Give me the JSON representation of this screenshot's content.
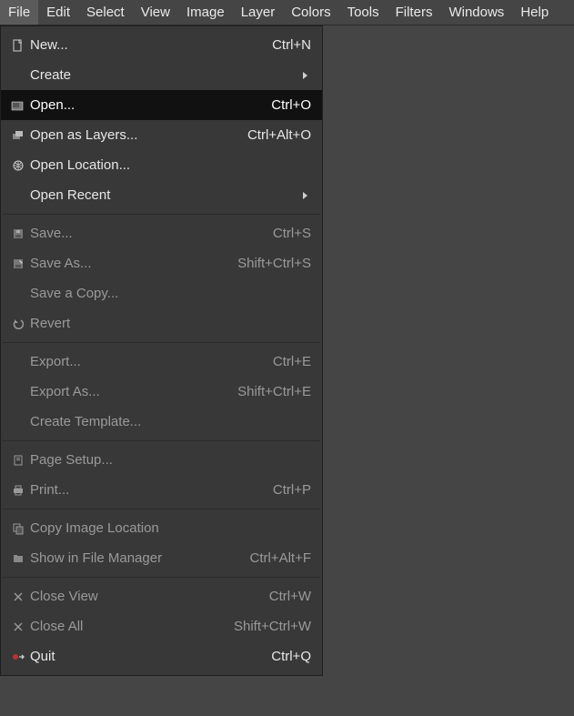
{
  "menubar": [
    {
      "label": "File",
      "active": true
    },
    {
      "label": "Edit"
    },
    {
      "label": "Select"
    },
    {
      "label": "View"
    },
    {
      "label": "Image"
    },
    {
      "label": "Layer"
    },
    {
      "label": "Colors"
    },
    {
      "label": "Tools"
    },
    {
      "label": "Filters"
    },
    {
      "label": "Windows"
    },
    {
      "label": "Help"
    }
  ],
  "file_menu": {
    "new": {
      "label": "New...",
      "shortcut": "Ctrl+N"
    },
    "create": {
      "label": "Create",
      "submenu": true
    },
    "open": {
      "label": "Open...",
      "shortcut": "Ctrl+O",
      "highlight": true
    },
    "open_layers": {
      "label": "Open as Layers...",
      "shortcut": "Ctrl+Alt+O"
    },
    "open_location": {
      "label": "Open Location..."
    },
    "open_recent": {
      "label": "Open Recent",
      "submenu": true
    },
    "save": {
      "label": "Save...",
      "shortcut": "Ctrl+S",
      "disabled": true
    },
    "save_as": {
      "label": "Save As...",
      "shortcut": "Shift+Ctrl+S",
      "disabled": true
    },
    "save_copy": {
      "label": "Save a Copy...",
      "disabled": true
    },
    "revert": {
      "label": "Revert",
      "disabled": true
    },
    "export": {
      "label": "Export...",
      "shortcut": "Ctrl+E",
      "disabled": true
    },
    "export_as": {
      "label": "Export As...",
      "shortcut": "Shift+Ctrl+E",
      "disabled": true
    },
    "create_template": {
      "label": "Create Template...",
      "disabled": true
    },
    "page_setup": {
      "label": "Page Setup...",
      "disabled": true
    },
    "print": {
      "label": "Print...",
      "shortcut": "Ctrl+P",
      "disabled": true
    },
    "copy_img_loc": {
      "label": "Copy Image Location",
      "disabled": true
    },
    "show_in_fm": {
      "label": "Show in File Manager",
      "shortcut": "Ctrl+Alt+F",
      "disabled": true
    },
    "close_view": {
      "label": "Close View",
      "shortcut": "Ctrl+W",
      "disabled": true
    },
    "close_all": {
      "label": "Close All",
      "shortcut": "Shift+Ctrl+W",
      "disabled": true
    },
    "quit": {
      "label": "Quit",
      "shortcut": "Ctrl+Q"
    }
  }
}
